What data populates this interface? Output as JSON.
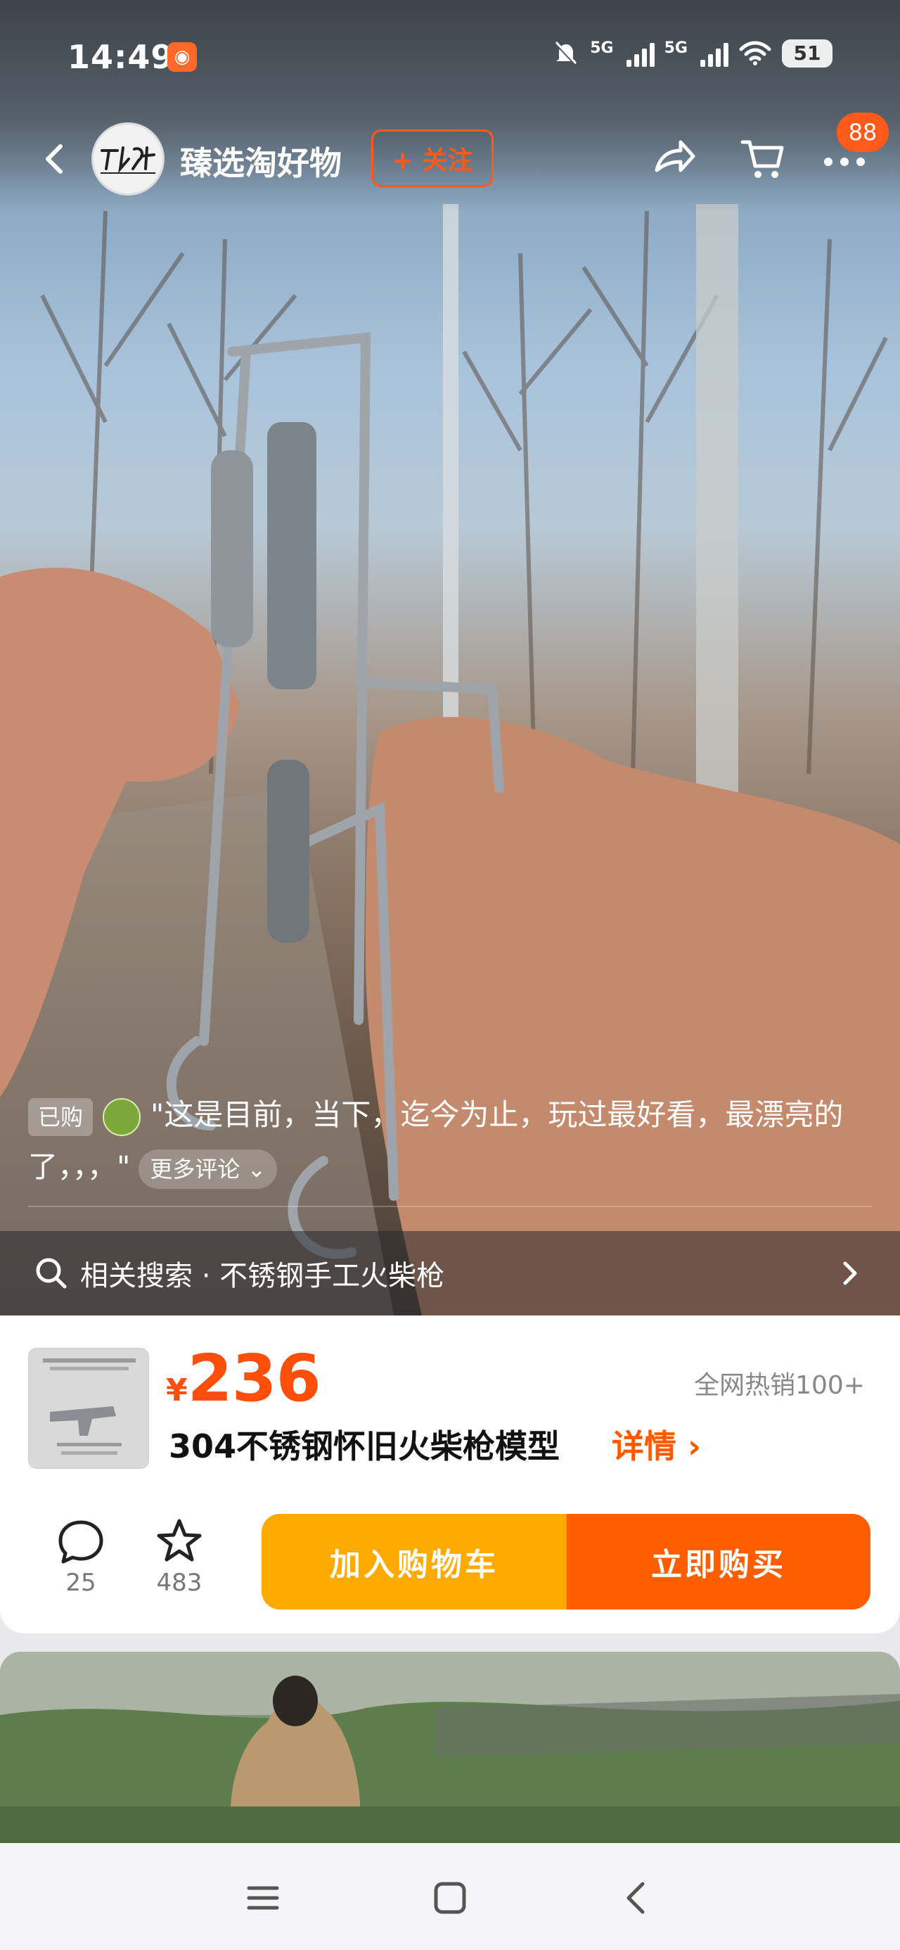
{
  "status_bar": {
    "time": "14:49",
    "network_1": "5G",
    "network_2": "5G",
    "battery": "51"
  },
  "header": {
    "shop_name": "臻选淘好物",
    "follow_label": "+ 关注",
    "cart_badge": "88",
    "icons": [
      "back-icon",
      "share-icon",
      "cart-icon",
      "more-icon"
    ]
  },
  "comment": {
    "bought_tag": "已购",
    "text": "\"这是目前，当下，迄今为止，玩过最好看，最漂亮的了，，，\"",
    "more_label": "更多评论"
  },
  "related_search": {
    "label": "相关搜索 · 不锈钢手工火柴枪"
  },
  "product": {
    "currency": "¥",
    "price": "236",
    "sales": "全网热销100+",
    "title": "304不锈钢怀旧火柴枪模型",
    "details_label": "详情"
  },
  "actions": {
    "comment_count": "25",
    "favorite_count": "483",
    "add_to_cart_label": "加入购物车",
    "buy_now_label": "立即购买"
  },
  "colors": {
    "accent": "#ff5a1a",
    "price": "#ff4d0a",
    "cart_button": "#ffaa00",
    "buy_button": "#ff5e00"
  }
}
